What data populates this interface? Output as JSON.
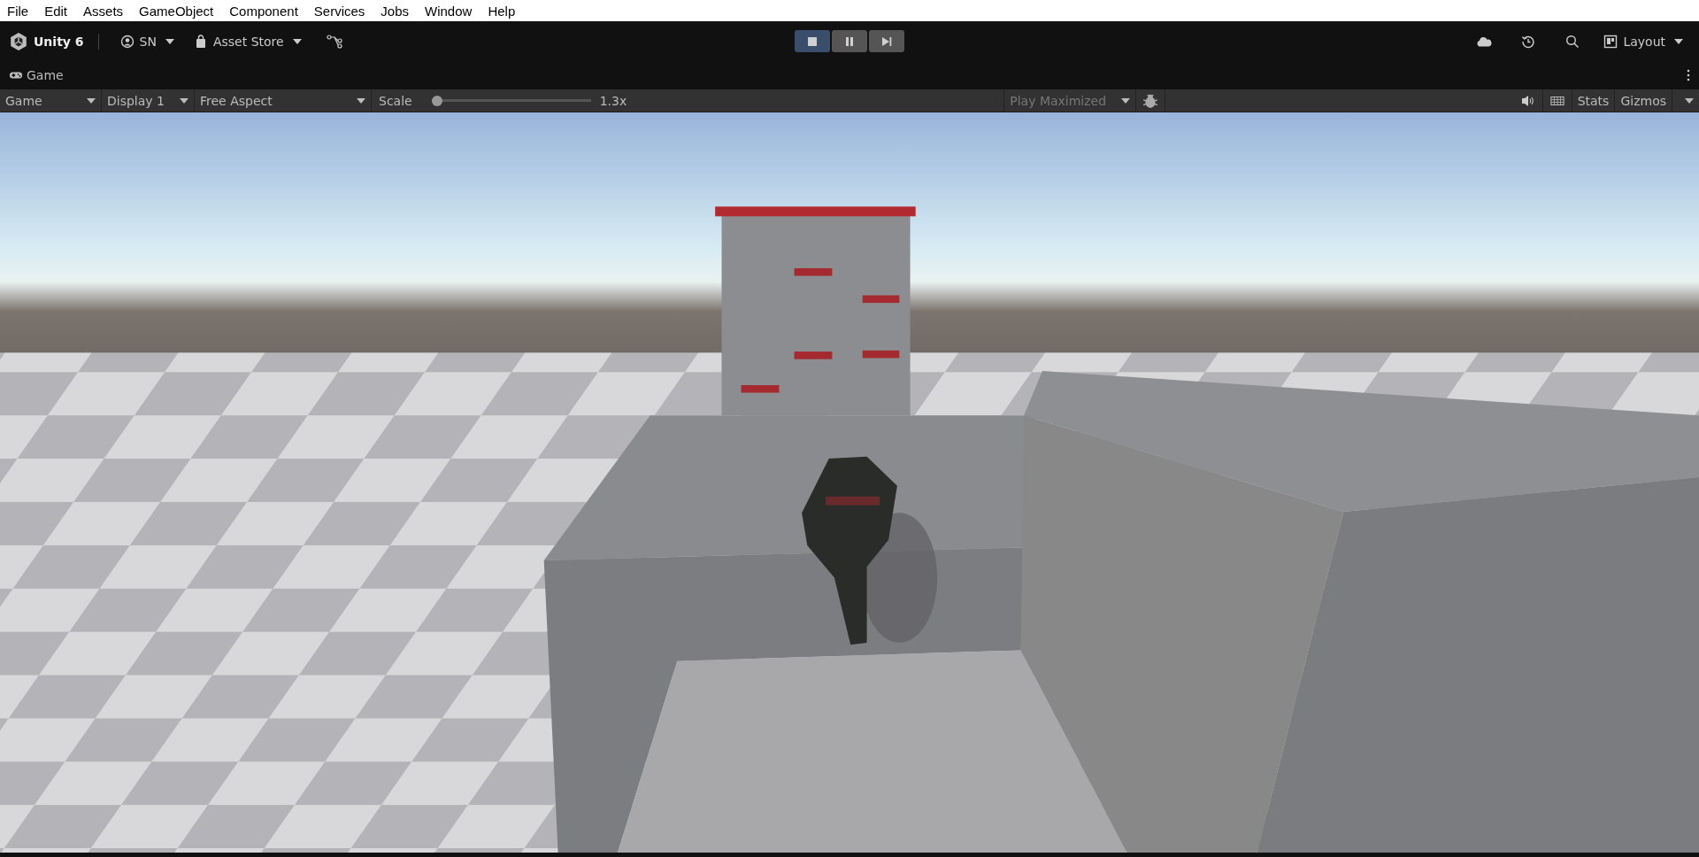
{
  "menu_bar": [
    "File",
    "Edit",
    "Assets",
    "GameObject",
    "Component",
    "Services",
    "Jobs",
    "Window",
    "Help"
  ],
  "toolbar": {
    "product": "Unity 6",
    "account": "SN",
    "asset_store": "Asset Store",
    "layout": "Layout",
    "play_controls": [
      {
        "kind": "stop",
        "selected": true
      },
      {
        "kind": "pause",
        "selected": false
      },
      {
        "kind": "step",
        "selected": false
      }
    ]
  },
  "game_tab": {
    "title": "Game"
  },
  "game_toolbar": {
    "view": "Game",
    "display": "Display 1",
    "aspect": "Free Aspect",
    "scale_label": "Scale",
    "scale": {
      "level": 0
    },
    "scale_reading": "1.3x",
    "play_mode": {
      "label": "Play Maximized",
      "disabled": true
    },
    "stats": "Stats",
    "gizmos": "Gizmos"
  }
}
